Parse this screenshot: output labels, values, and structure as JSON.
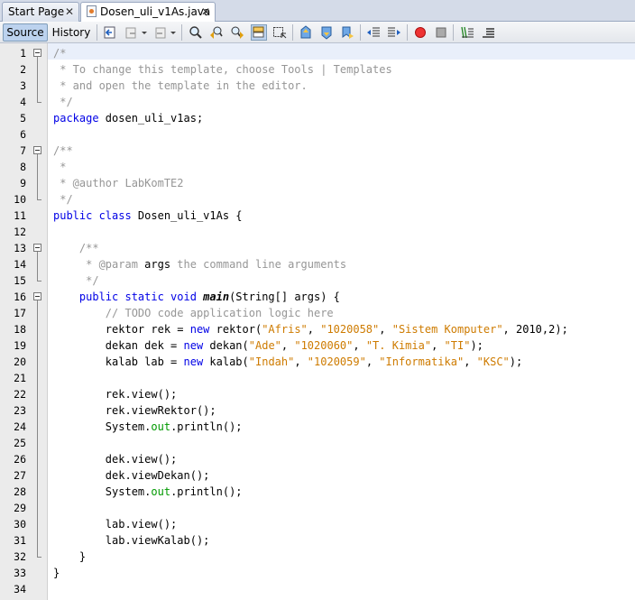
{
  "tabs": [
    {
      "label": "Start Page",
      "close": "✕"
    },
    {
      "label": "Dosen_uli_v1As.java",
      "close": "✕",
      "active": true
    }
  ],
  "toolbar": {
    "source_label": "Source",
    "history_label": "History",
    "icons": [
      "last-edit-icon",
      "back-icon",
      "forward-icon",
      "find-icon",
      "find-previous-icon",
      "find-next-icon",
      "toggle-highlight-icon",
      "toggle-rect-select-icon",
      "previous-bookmark-icon",
      "next-bookmark-icon",
      "toggle-bookmark-icon",
      "shift-left-icon",
      "shift-right-icon",
      "start-macro-icon",
      "stop-macro-icon",
      "comment-icon",
      "uncomment-icon"
    ]
  },
  "colors": {
    "keyword": "#0000e6",
    "string": "#ce7b00",
    "comment": "#969696",
    "field": "#009900"
  },
  "editor": {
    "lines": [
      {
        "n": "1",
        "tokens": [
          [
            "c",
            "/*"
          ]
        ]
      },
      {
        "n": "2",
        "tokens": [
          [
            "c",
            " * To change this template, choose Tools | Templates"
          ]
        ]
      },
      {
        "n": "3",
        "tokens": [
          [
            "c",
            " * and open the template in the editor."
          ]
        ]
      },
      {
        "n": "4",
        "tokens": [
          [
            "c",
            " */"
          ]
        ]
      },
      {
        "n": "5",
        "tokens": [
          [
            "k",
            "package"
          ],
          [
            "t",
            " dosen_uli_v1as;"
          ]
        ]
      },
      {
        "n": "6",
        "tokens": []
      },
      {
        "n": "7",
        "tokens": [
          [
            "c",
            "/**"
          ]
        ]
      },
      {
        "n": "8",
        "tokens": [
          [
            "c",
            " *"
          ]
        ]
      },
      {
        "n": "9",
        "tokens": [
          [
            "c",
            " * @author LabKomTE2"
          ]
        ]
      },
      {
        "n": "10",
        "tokens": [
          [
            "c",
            " */"
          ]
        ]
      },
      {
        "n": "11",
        "tokens": [
          [
            "k",
            "public class"
          ],
          [
            "t",
            " Dosen_uli_v1As {"
          ]
        ]
      },
      {
        "n": "12",
        "tokens": []
      },
      {
        "n": "13",
        "tokens": [
          [
            "c",
            "    /**"
          ]
        ]
      },
      {
        "n": "14",
        "tokens": [
          [
            "c",
            "     * @param "
          ],
          [
            "t",
            "args"
          ],
          [
            "c",
            " the command line arguments"
          ]
        ]
      },
      {
        "n": "15",
        "tokens": [
          [
            "c",
            "     */"
          ]
        ]
      },
      {
        "n": "16",
        "tokens": [
          [
            "k",
            "    public static void "
          ],
          [
            "m",
            "main"
          ],
          [
            "t",
            "(String[] args) {"
          ]
        ]
      },
      {
        "n": "17",
        "tokens": [
          [
            "c",
            "        // TODO code application logic here"
          ]
        ]
      },
      {
        "n": "18",
        "tokens": [
          [
            "t",
            "        rektor rek = "
          ],
          [
            "k",
            "new"
          ],
          [
            "t",
            " rektor("
          ],
          [
            "s",
            "\"Afris\""
          ],
          [
            "t",
            ", "
          ],
          [
            "s",
            "\"1020058\""
          ],
          [
            "t",
            ", "
          ],
          [
            "s",
            "\"Sistem Komputer\""
          ],
          [
            "t",
            ", 2010,2);"
          ]
        ]
      },
      {
        "n": "19",
        "tokens": [
          [
            "t",
            "        dekan dek = "
          ],
          [
            "k",
            "new"
          ],
          [
            "t",
            " dekan("
          ],
          [
            "s",
            "\"Ade\""
          ],
          [
            "t",
            ", "
          ],
          [
            "s",
            "\"1020060\""
          ],
          [
            "t",
            ", "
          ],
          [
            "s",
            "\"T. Kimia\""
          ],
          [
            "t",
            ", "
          ],
          [
            "s",
            "\"TI\""
          ],
          [
            "t",
            ");"
          ]
        ]
      },
      {
        "n": "20",
        "tokens": [
          [
            "t",
            "        kalab lab = "
          ],
          [
            "k",
            "new"
          ],
          [
            "t",
            " kalab("
          ],
          [
            "s",
            "\"Indah\""
          ],
          [
            "t",
            ", "
          ],
          [
            "s",
            "\"1020059\""
          ],
          [
            "t",
            ", "
          ],
          [
            "s",
            "\"Informatika\""
          ],
          [
            "t",
            ", "
          ],
          [
            "s",
            "\"KSC\""
          ],
          [
            "t",
            ");"
          ]
        ]
      },
      {
        "n": "21",
        "tokens": []
      },
      {
        "n": "22",
        "tokens": [
          [
            "t",
            "        rek.view();"
          ]
        ]
      },
      {
        "n": "23",
        "tokens": [
          [
            "t",
            "        rek.viewRektor();"
          ]
        ]
      },
      {
        "n": "24",
        "tokens": [
          [
            "t",
            "        System."
          ],
          [
            "f",
            "out"
          ],
          [
            "t",
            ".println();"
          ]
        ]
      },
      {
        "n": "25",
        "tokens": []
      },
      {
        "n": "26",
        "tokens": [
          [
            "t",
            "        dek.view();"
          ]
        ]
      },
      {
        "n": "27",
        "tokens": [
          [
            "t",
            "        dek.viewDekan();"
          ]
        ]
      },
      {
        "n": "28",
        "tokens": [
          [
            "t",
            "        System."
          ],
          [
            "f",
            "out"
          ],
          [
            "t",
            ".println();"
          ]
        ]
      },
      {
        "n": "29",
        "tokens": []
      },
      {
        "n": "30",
        "tokens": [
          [
            "t",
            "        lab.view();"
          ]
        ]
      },
      {
        "n": "31",
        "tokens": [
          [
            "t",
            "        lab.viewKalab();"
          ]
        ]
      },
      {
        "n": "32",
        "tokens": [
          [
            "t",
            "    }"
          ]
        ]
      },
      {
        "n": "33",
        "tokens": [
          [
            "t",
            "}"
          ]
        ]
      },
      {
        "n": "34",
        "tokens": []
      }
    ]
  }
}
